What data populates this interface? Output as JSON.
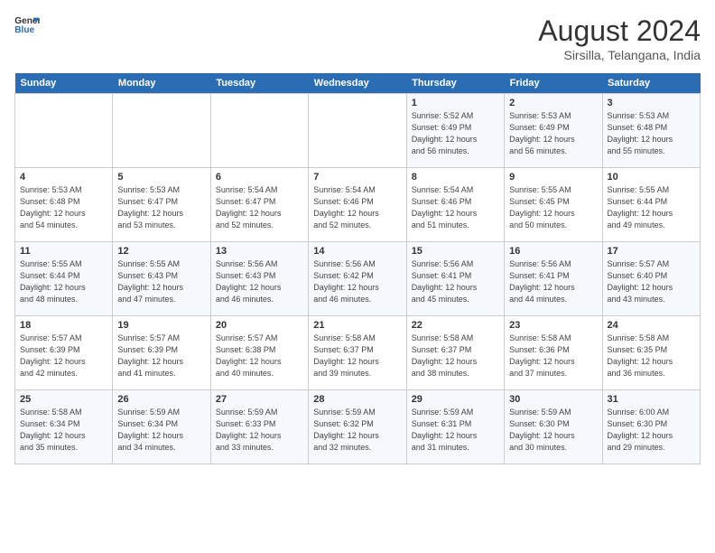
{
  "header": {
    "logo_line1": "General",
    "logo_line2": "Blue",
    "month_title": "August 2024",
    "location": "Sirsilla, Telangana, India"
  },
  "weekdays": [
    "Sunday",
    "Monday",
    "Tuesday",
    "Wednesday",
    "Thursday",
    "Friday",
    "Saturday"
  ],
  "weeks": [
    [
      {
        "day": "",
        "info": ""
      },
      {
        "day": "",
        "info": ""
      },
      {
        "day": "",
        "info": ""
      },
      {
        "day": "",
        "info": ""
      },
      {
        "day": "1",
        "info": "Sunrise: 5:52 AM\nSunset: 6:49 PM\nDaylight: 12 hours\nand 56 minutes."
      },
      {
        "day": "2",
        "info": "Sunrise: 5:53 AM\nSunset: 6:49 PM\nDaylight: 12 hours\nand 56 minutes."
      },
      {
        "day": "3",
        "info": "Sunrise: 5:53 AM\nSunset: 6:48 PM\nDaylight: 12 hours\nand 55 minutes."
      }
    ],
    [
      {
        "day": "4",
        "info": "Sunrise: 5:53 AM\nSunset: 6:48 PM\nDaylight: 12 hours\nand 54 minutes."
      },
      {
        "day": "5",
        "info": "Sunrise: 5:53 AM\nSunset: 6:47 PM\nDaylight: 12 hours\nand 53 minutes."
      },
      {
        "day": "6",
        "info": "Sunrise: 5:54 AM\nSunset: 6:47 PM\nDaylight: 12 hours\nand 52 minutes."
      },
      {
        "day": "7",
        "info": "Sunrise: 5:54 AM\nSunset: 6:46 PM\nDaylight: 12 hours\nand 52 minutes."
      },
      {
        "day": "8",
        "info": "Sunrise: 5:54 AM\nSunset: 6:46 PM\nDaylight: 12 hours\nand 51 minutes."
      },
      {
        "day": "9",
        "info": "Sunrise: 5:55 AM\nSunset: 6:45 PM\nDaylight: 12 hours\nand 50 minutes."
      },
      {
        "day": "10",
        "info": "Sunrise: 5:55 AM\nSunset: 6:44 PM\nDaylight: 12 hours\nand 49 minutes."
      }
    ],
    [
      {
        "day": "11",
        "info": "Sunrise: 5:55 AM\nSunset: 6:44 PM\nDaylight: 12 hours\nand 48 minutes."
      },
      {
        "day": "12",
        "info": "Sunrise: 5:55 AM\nSunset: 6:43 PM\nDaylight: 12 hours\nand 47 minutes."
      },
      {
        "day": "13",
        "info": "Sunrise: 5:56 AM\nSunset: 6:43 PM\nDaylight: 12 hours\nand 46 minutes."
      },
      {
        "day": "14",
        "info": "Sunrise: 5:56 AM\nSunset: 6:42 PM\nDaylight: 12 hours\nand 46 minutes."
      },
      {
        "day": "15",
        "info": "Sunrise: 5:56 AM\nSunset: 6:41 PM\nDaylight: 12 hours\nand 45 minutes."
      },
      {
        "day": "16",
        "info": "Sunrise: 5:56 AM\nSunset: 6:41 PM\nDaylight: 12 hours\nand 44 minutes."
      },
      {
        "day": "17",
        "info": "Sunrise: 5:57 AM\nSunset: 6:40 PM\nDaylight: 12 hours\nand 43 minutes."
      }
    ],
    [
      {
        "day": "18",
        "info": "Sunrise: 5:57 AM\nSunset: 6:39 PM\nDaylight: 12 hours\nand 42 minutes."
      },
      {
        "day": "19",
        "info": "Sunrise: 5:57 AM\nSunset: 6:39 PM\nDaylight: 12 hours\nand 41 minutes."
      },
      {
        "day": "20",
        "info": "Sunrise: 5:57 AM\nSunset: 6:38 PM\nDaylight: 12 hours\nand 40 minutes."
      },
      {
        "day": "21",
        "info": "Sunrise: 5:58 AM\nSunset: 6:37 PM\nDaylight: 12 hours\nand 39 minutes."
      },
      {
        "day": "22",
        "info": "Sunrise: 5:58 AM\nSunset: 6:37 PM\nDaylight: 12 hours\nand 38 minutes."
      },
      {
        "day": "23",
        "info": "Sunrise: 5:58 AM\nSunset: 6:36 PM\nDaylight: 12 hours\nand 37 minutes."
      },
      {
        "day": "24",
        "info": "Sunrise: 5:58 AM\nSunset: 6:35 PM\nDaylight: 12 hours\nand 36 minutes."
      }
    ],
    [
      {
        "day": "25",
        "info": "Sunrise: 5:58 AM\nSunset: 6:34 PM\nDaylight: 12 hours\nand 35 minutes."
      },
      {
        "day": "26",
        "info": "Sunrise: 5:59 AM\nSunset: 6:34 PM\nDaylight: 12 hours\nand 34 minutes."
      },
      {
        "day": "27",
        "info": "Sunrise: 5:59 AM\nSunset: 6:33 PM\nDaylight: 12 hours\nand 33 minutes."
      },
      {
        "day": "28",
        "info": "Sunrise: 5:59 AM\nSunset: 6:32 PM\nDaylight: 12 hours\nand 32 minutes."
      },
      {
        "day": "29",
        "info": "Sunrise: 5:59 AM\nSunset: 6:31 PM\nDaylight: 12 hours\nand 31 minutes."
      },
      {
        "day": "30",
        "info": "Sunrise: 5:59 AM\nSunset: 6:30 PM\nDaylight: 12 hours\nand 30 minutes."
      },
      {
        "day": "31",
        "info": "Sunrise: 6:00 AM\nSunset: 6:30 PM\nDaylight: 12 hours\nand 29 minutes."
      }
    ]
  ]
}
